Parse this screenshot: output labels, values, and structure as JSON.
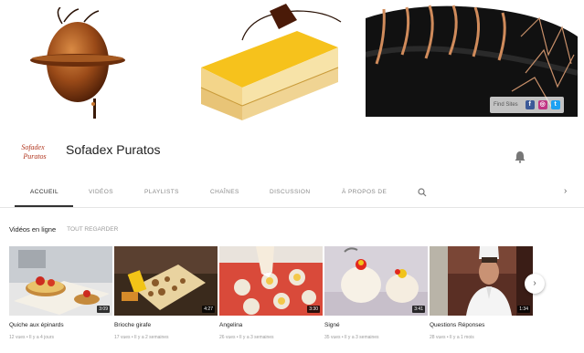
{
  "banner": {
    "social_label": "Find Sites",
    "social_icons": [
      "facebook-icon",
      "instagram-icon",
      "twitter-icon"
    ]
  },
  "channel": {
    "logo_text_line1": "Sofadex",
    "logo_text_line2": "Puratos",
    "name": "Sofadex Puratos"
  },
  "tabs": [
    {
      "label": "ACCUEIL",
      "active": true
    },
    {
      "label": "VIDÉOS",
      "active": false
    },
    {
      "label": "PLAYLISTS",
      "active": false
    },
    {
      "label": "CHAÎNES",
      "active": false
    },
    {
      "label": "DISCUSSION",
      "active": false
    },
    {
      "label": "À PROPOS DE",
      "active": false
    }
  ],
  "section": {
    "title": "Vidéos en ligne",
    "link": "TOUT REGARDER"
  },
  "videos": [
    {
      "title": "Quiche aux épinards",
      "meta": "12 vues • Il y a 4 jours",
      "duration": "3:09"
    },
    {
      "title": "Brioche girafe",
      "meta": "17 vues • Il y a 2 semaines",
      "duration": "4:27"
    },
    {
      "title": "Angelina",
      "meta": "26 vues • Il y a 3 semaines",
      "duration": "3:30"
    },
    {
      "title": "Signé",
      "meta": "35 vues • Il y a 3 semaines",
      "duration": "3:41"
    },
    {
      "title": "Questions Réponses",
      "meta": "28 vues • Il y a 1 mois",
      "duration": "1:34"
    }
  ],
  "colors": {
    "accent": "#333333",
    "chocolate": "#7a3b12",
    "mango": "#f6c21c",
    "muted_text": "#8a8a8a"
  }
}
